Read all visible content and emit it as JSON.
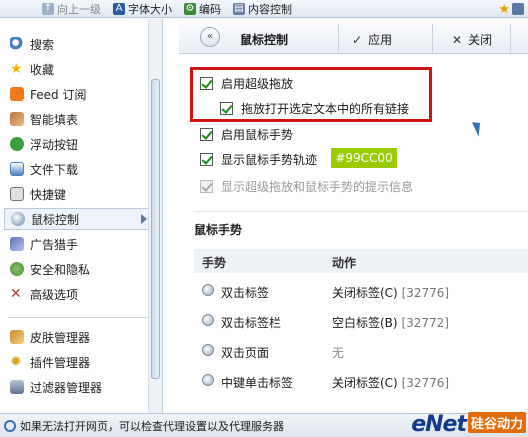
{
  "toolbar": {
    "items": [
      {
        "label": "向上一级",
        "icon": "up-arrow-icon",
        "enabled": false
      },
      {
        "label": "字体大小",
        "icon": "font-size-icon",
        "enabled": true
      },
      {
        "label": "编码",
        "icon": "encoding-icon",
        "enabled": true
      },
      {
        "label": "内容控制",
        "icon": "content-control-icon",
        "enabled": true
      }
    ]
  },
  "sidebar": {
    "items": [
      {
        "label": "搜索",
        "icon": "search-icon",
        "color": "#4a7fc0"
      },
      {
        "label": "收藏",
        "icon": "star-icon",
        "color": "#f0b400"
      },
      {
        "label": "Feed 订阅",
        "icon": "feed-icon",
        "color": "#f07a1a"
      },
      {
        "label": "智能填表",
        "icon": "form-fill-icon",
        "color": "#c0703a"
      },
      {
        "label": "浮动按钮",
        "icon": "float-button-icon",
        "color": "#3aa03a"
      },
      {
        "label": "文件下载",
        "icon": "download-icon",
        "color": "#4a80c0"
      },
      {
        "label": "快捷键",
        "icon": "keyboard-icon",
        "color": "#707070"
      },
      {
        "label": "鼠标控制",
        "icon": "mouse-icon",
        "color": "#6080a8",
        "active": true
      },
      {
        "label": "广告猎手",
        "icon": "ad-hunter-icon",
        "color": "#6070b8"
      },
      {
        "label": "安全和隐私",
        "icon": "security-icon",
        "color": "#4a9040"
      },
      {
        "label": "高级选项",
        "icon": "tools-icon",
        "color": "#c04040"
      },
      {
        "label": "皮肤管理器",
        "icon": "skin-icon",
        "color": "#d08a2a"
      },
      {
        "label": "插件管理器",
        "icon": "plugin-icon",
        "color": "#e0a020"
      },
      {
        "label": "过滤器管理器",
        "icon": "filter-icon",
        "color": "#607090"
      }
    ]
  },
  "panel": {
    "title": "鼠标控制",
    "apply_label": "应用",
    "close_label": "关闭",
    "options": {
      "super_drag": {
        "label": "启用超级拖放",
        "checked": true
      },
      "drag_open_links": {
        "label": "拖放打开选定文本中的所有链接",
        "checked": true
      },
      "gestures": {
        "label": "启用鼠标手势",
        "checked": true
      },
      "show_trail": {
        "label": "显示鼠标手势轨迹",
        "checked": true
      },
      "show_tips": {
        "label": "显示超级拖放和鼠标手势的提示信息",
        "checked": true,
        "disabled": true
      }
    },
    "trail_color": "#99CC00",
    "gesture_section_title": "鼠标手势",
    "table": {
      "headers": [
        "手势",
        "动作"
      ],
      "rows": [
        {
          "gesture": "双击标签",
          "action": "关闭标签(C)",
          "code": "[32776]"
        },
        {
          "gesture": "双击标签栏",
          "action": "空白标签(B)",
          "code": "[32772]"
        },
        {
          "gesture": "双击页面",
          "action": "无",
          "code": ""
        },
        {
          "gesture": "中键单击标签",
          "action": "关闭标签(C)",
          "code": "[32776]"
        }
      ]
    }
  },
  "status": {
    "text": "如果无法打开网页，可以检查代理设置以及代理服务器"
  },
  "logo": {
    "part1": "eNet",
    "part2": "硅谷动力"
  }
}
